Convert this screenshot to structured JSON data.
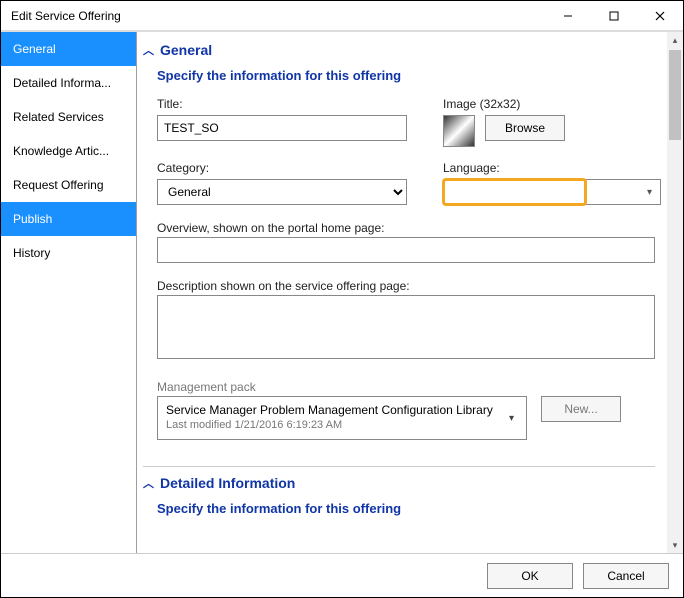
{
  "window": {
    "title": "Edit Service Offering"
  },
  "sidebar": {
    "items": [
      {
        "label": "General",
        "selected": true
      },
      {
        "label": "Detailed Informa...",
        "selected": false
      },
      {
        "label": "Related Services",
        "selected": false
      },
      {
        "label": "Knowledge Artic...",
        "selected": false
      },
      {
        "label": "Request Offering",
        "selected": false
      },
      {
        "label": "Publish",
        "selected": true
      },
      {
        "label": "History",
        "selected": false
      }
    ]
  },
  "section_general": {
    "header": "General",
    "sub": "Specify the information for this offering",
    "title_label": "Title:",
    "title_value": "TEST_SO",
    "image_label": "Image (32x32)",
    "browse_label": "Browse",
    "category_label": "Category:",
    "category_value": "General",
    "language_label": "Language:",
    "language_value": "",
    "overview_label": "Overview, shown on the portal home page:",
    "overview_value": "",
    "description_label": "Description shown on the service offering page:",
    "description_value": "",
    "mp_label": "Management pack",
    "mp_value": "Service Manager Problem Management Configuration Library",
    "mp_modified": "Last modified  1/21/2016 6:19:23 AM",
    "mp_new_label": "New..."
  },
  "section_detailed": {
    "header": "Detailed Information",
    "sub": "Specify the information for this offering"
  },
  "footer": {
    "ok": "OK",
    "cancel": "Cancel"
  }
}
